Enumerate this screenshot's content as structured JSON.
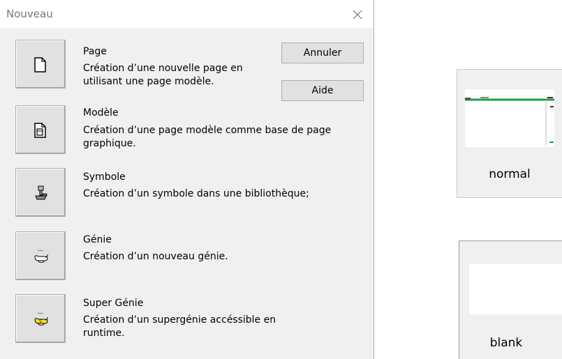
{
  "dialog": {
    "title": "Nouveau",
    "close_icon": "close-icon",
    "cancel_label": "Annuler",
    "help_label": "Aide",
    "options": [
      {
        "title": "Page",
        "desc": "Création d’une nouvelle page en utilisant une page modèle.",
        "icon": "page-icon"
      },
      {
        "title": "Modèle",
        "desc": "Création d’une page modèle comme base de page graphique.",
        "icon": "template-page-icon"
      },
      {
        "title": "Symbole",
        "desc": "Création d’un symbole dans une bibliothèque;",
        "icon": "symbol-icon"
      },
      {
        "title": "Génie",
        "desc": "Création d’un nouveau génie.",
        "icon": "genie-lamp-icon"
      },
      {
        "title": "Super Génie",
        "desc": "Création d’un supergénie accéssible en runtime.",
        "icon": "super-genie-lamp-icon"
      }
    ]
  },
  "templates": [
    {
      "label": "normal"
    },
    {
      "label": "blank"
    }
  ],
  "colors": {
    "accent_green": "#1e9e3a",
    "dialog_bg": "#f0f0f0",
    "button_face": "#e1e1e1",
    "button_border": "#adadad"
  }
}
